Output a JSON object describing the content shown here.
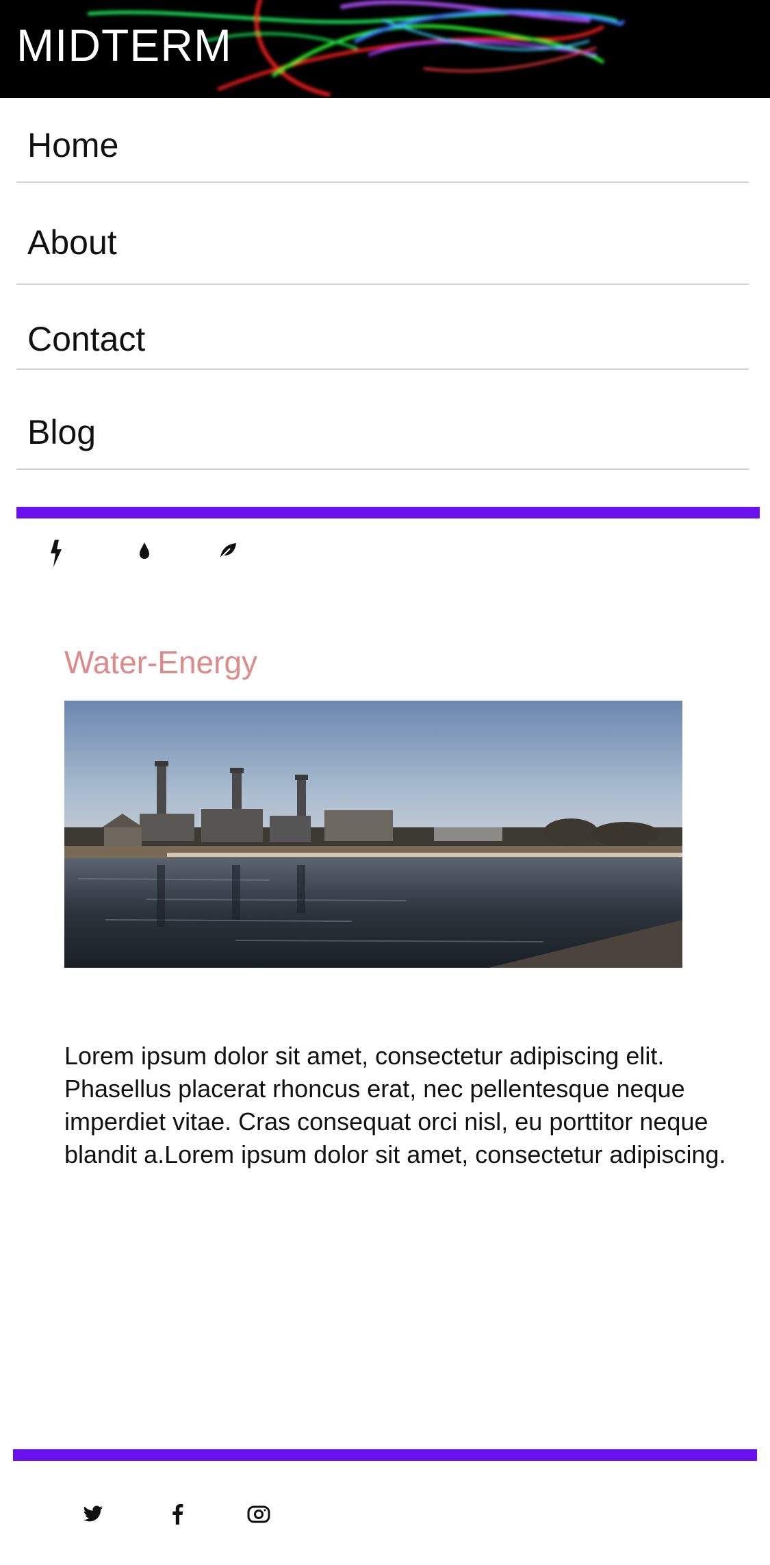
{
  "header": {
    "brand": "MIDTERM"
  },
  "nav": {
    "items": [
      {
        "label": "Home"
      },
      {
        "label": "About"
      },
      {
        "label": "Contact"
      },
      {
        "label": "Blog"
      }
    ]
  },
  "colors": {
    "accent": "#6a12ee",
    "title": "#de8a8a",
    "header_bg": "#000000"
  },
  "category_icons": [
    "lightning-icon",
    "water-drop-icon",
    "leaf-icon"
  ],
  "article": {
    "title": "Water-Energy",
    "image": "power-plant-river-photo",
    "body": "Lorem ipsum dolor sit amet, consectetur adipiscing elit. Phasellus placerat rhoncus erat, nec pellentesque neque imperdiet vitae. Cras consequat orci nisl, eu porttitor neque blandit a.Lorem ipsum dolor sit amet, consectetur adipiscing."
  },
  "social_icons": [
    "twitter-icon",
    "facebook-icon",
    "instagram-icon"
  ]
}
